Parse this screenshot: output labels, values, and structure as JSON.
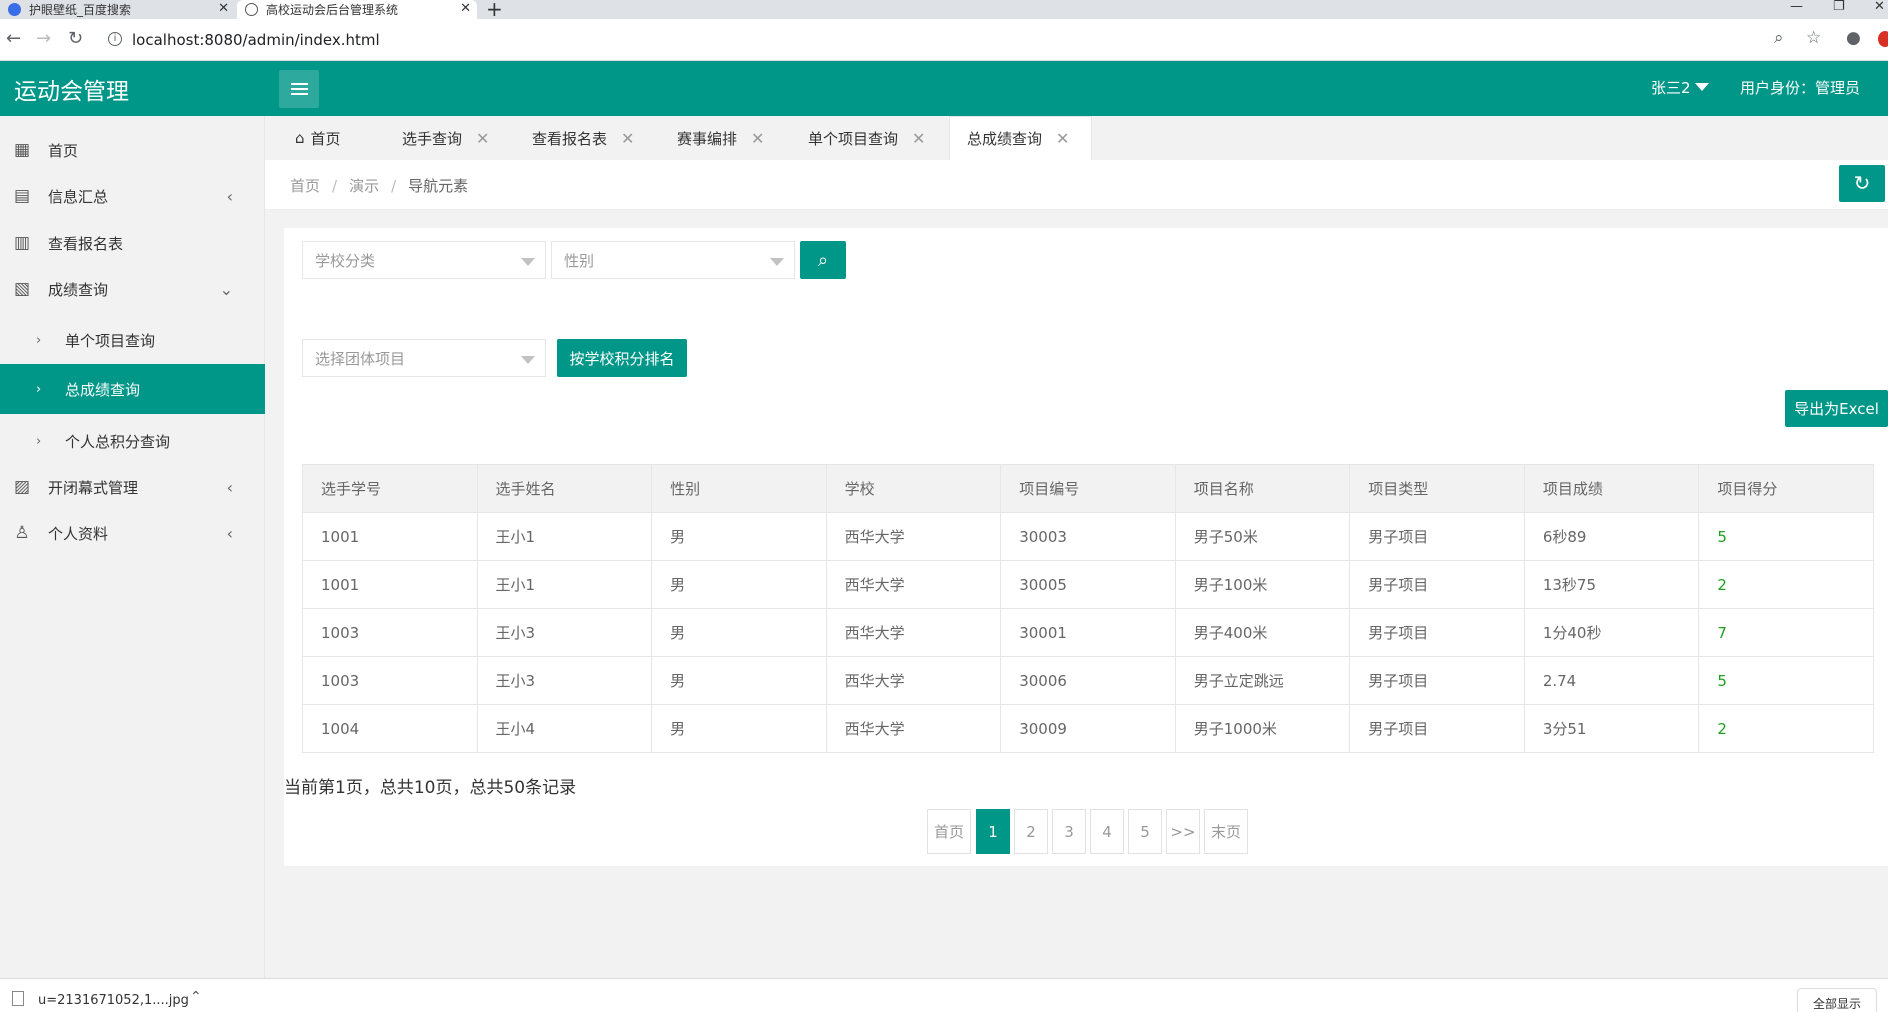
{
  "browser": {
    "tabs": [
      {
        "title": "护眼壁纸_百度搜索"
      },
      {
        "title": "高校运动会后台管理系统"
      }
    ],
    "url": "localhost:8080/admin/index.html"
  },
  "header": {
    "logo": "运动会管理",
    "user_name": "张三2",
    "role": "用户身份：管理员"
  },
  "sidebar": {
    "items": [
      {
        "label": "首页",
        "icon": "grid-icon"
      },
      {
        "label": "信息汇总",
        "icon": "document-icon"
      },
      {
        "label": "查看报名表",
        "icon": "list-icon"
      },
      {
        "label": "成绩查询",
        "icon": "edit-doc-icon"
      },
      {
        "label": "单个项目查询"
      },
      {
        "label": "总成绩查询"
      },
      {
        "label": "个人总积分查询"
      },
      {
        "label": "开闭幕式管理",
        "icon": "settings-doc-icon"
      },
      {
        "label": "个人资料",
        "icon": "user-icon"
      }
    ]
  },
  "page_tabs": [
    {
      "label": "首页"
    },
    {
      "label": "选手查询"
    },
    {
      "label": "查看报名表"
    },
    {
      "label": "赛事编排"
    },
    {
      "label": "单个项目查询"
    },
    {
      "label": "总成绩查询"
    }
  ],
  "breadcrumb": [
    "首页",
    "演示",
    "导航元素"
  ],
  "filters": {
    "school_placeholder": "学校分类",
    "gender_placeholder": "性别",
    "team_placeholder": "选择团体项目",
    "rank_button": "按学校积分排名",
    "export_button": "导出为Excel"
  },
  "table": {
    "headers": [
      "选手学号",
      "选手姓名",
      "性别",
      "学校",
      "项目编号",
      "项目名称",
      "项目类型",
      "项目成绩",
      "项目得分"
    ],
    "rows": [
      [
        "1001",
        "王小1",
        "男",
        "西华大学",
        "30003",
        "男子50米",
        "男子项目",
        "6秒89",
        "5"
      ],
      [
        "1001",
        "王小1",
        "男",
        "西华大学",
        "30005",
        "男子100米",
        "男子项目",
        "13秒75",
        "2"
      ],
      [
        "1003",
        "王小3",
        "男",
        "西华大学",
        "30001",
        "男子400米",
        "男子项目",
        "1分40秒",
        "7"
      ],
      [
        "1003",
        "王小3",
        "男",
        "西华大学",
        "30006",
        "男子立定跳远",
        "男子项目",
        "2.74",
        "5"
      ],
      [
        "1004",
        "王小4",
        "男",
        "西华大学",
        "30009",
        "男子1000米",
        "男子项目",
        "3分51",
        "2"
      ]
    ]
  },
  "pagination": {
    "info": "当前第1页，总共10页，总共50条记录",
    "first": "首页",
    "pages": [
      "1",
      "2",
      "3",
      "4",
      "5"
    ],
    "next": ">>",
    "last": "末页"
  },
  "download": {
    "file": "u=2131671052,1....jpg",
    "show_all": "全部显示"
  },
  "colors": {
    "primary": "#009688",
    "score": "#1e9f1e"
  }
}
